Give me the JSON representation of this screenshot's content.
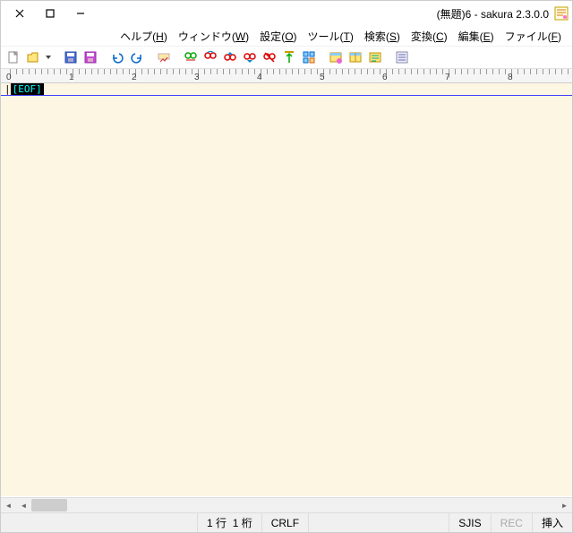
{
  "title": "(無題)6 - sakura 2.3.0.0",
  "menus": [
    {
      "label": "ヘルプ",
      "key": "H"
    },
    {
      "label": "ウィンドウ",
      "key": "W"
    },
    {
      "label": "設定",
      "key": "O"
    },
    {
      "label": "ツール",
      "key": "T"
    },
    {
      "label": "検索",
      "key": "S"
    },
    {
      "label": "変換",
      "key": "C"
    },
    {
      "label": "編集",
      "key": "E"
    },
    {
      "label": "ファイル",
      "key": "F"
    }
  ],
  "ruler_numbers": [
    "0",
    "1",
    "2",
    "3",
    "4",
    "5",
    "6",
    "7",
    "8"
  ],
  "eof_text": "[EOF]",
  "status": {
    "line": "1 行",
    "col": "1 桁",
    "eol": "CRLF",
    "encoding": "SJIS",
    "rec": "REC",
    "mode": "挿入"
  },
  "toolbar_icons": [
    "new-file",
    "open-file",
    "open-dropdown",
    "sep",
    "save",
    "save-all",
    "sep",
    "undo",
    "redo",
    "sep",
    "execute",
    "sep",
    "search-pair",
    "bookmark",
    "prev-bookmark",
    "next-bookmark",
    "clear-bookmark",
    "jump",
    "outline",
    "sep",
    "window-list",
    "compare",
    "diff",
    "sep",
    "type-list"
  ]
}
